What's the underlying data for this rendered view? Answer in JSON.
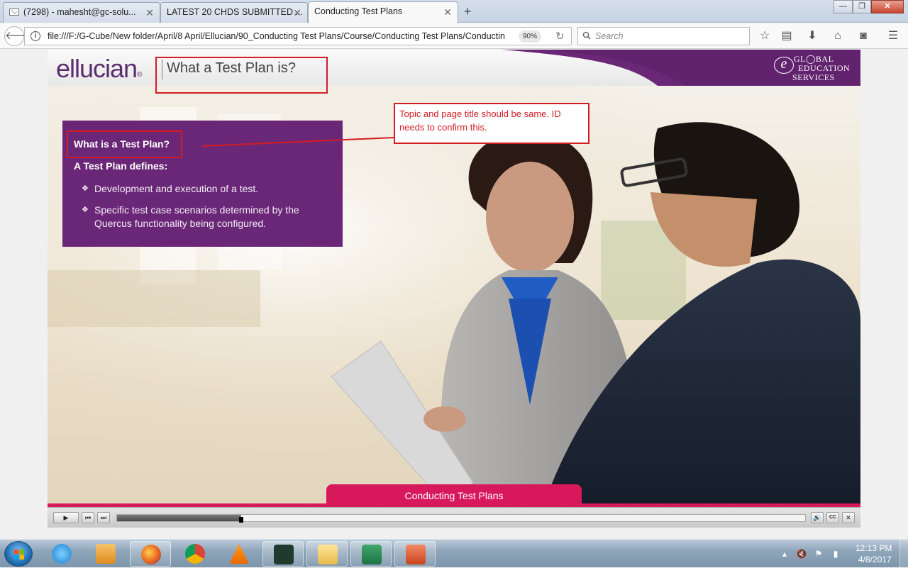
{
  "browser": {
    "tabs": [
      {
        "label": "(7298) - mahesht@gc-solu...",
        "icon": "mail-icon",
        "active": false
      },
      {
        "label": "LATEST 20 CHDS SUBMITTED ...",
        "icon": "document-icon",
        "active": false
      },
      {
        "label": "Conducting Test Plans",
        "icon": "none",
        "active": true
      }
    ],
    "new_tab_label": "+",
    "window_controls": {
      "minimize": "—",
      "restore": "❐",
      "close": "✕"
    },
    "url": "file:///F:/G-Cube/New folder/April/8 April/Ellucian/90_Conducting Test Plans/Course/Conducting Test Plans/Conductin",
    "zoom": "90%",
    "search_placeholder": "Search"
  },
  "course": {
    "logo_text": "ellucian",
    "logo_reg": "®",
    "page_title": "What a Test Plan is?",
    "partner_logo": {
      "letter": "e",
      "line1": "GL◯BAL",
      "line2": "EDUCATION",
      "line3": "SERVICES"
    },
    "panel": {
      "heading": "What is a Test Plan?",
      "subheading": "A Test Plan defines:",
      "bullets": [
        "Development and execution of a test.",
        "Specific test case scenarios determined by the Quercus functionality being configured."
      ],
      "bullet_glyph": "❖"
    },
    "footer_title": "Conducting Test Plans",
    "accent_color": "#d7185b",
    "panel_color": "#6b2777"
  },
  "player": {
    "play": "▶",
    "prev": "⏮",
    "next": "⏭",
    "volume": "🔊",
    "cc": "CC",
    "close": "✕",
    "progress_fraction": 0.18
  },
  "annotation": {
    "note": "Topic and page title should be same. ID needs to confirm this.",
    "color": "#d21c24"
  },
  "taskbar": {
    "apps": [
      "ie-icon",
      "media-player-icon",
      "firefox-icon",
      "chrome-icon",
      "vlc-icon",
      "scite-icon",
      "file-explorer-icon",
      "excel-icon",
      "powerpoint-icon"
    ],
    "time": "12:13 PM",
    "date": "4/8/2017"
  }
}
